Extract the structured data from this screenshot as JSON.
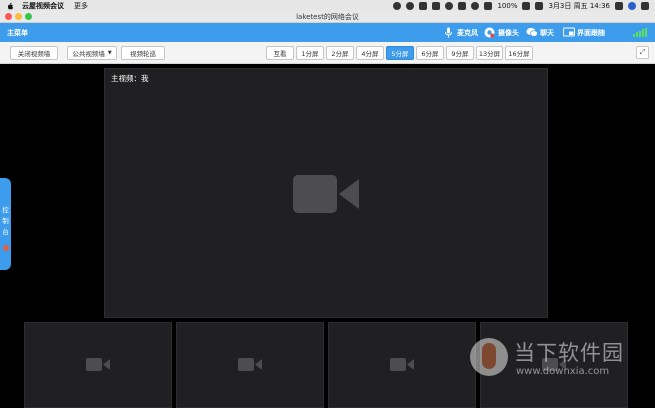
{
  "mac_menubar": {
    "app_name": "云屋视频会议",
    "menu_more": "更多",
    "battery": "100%",
    "datetime": "3月3日 周五  14:36"
  },
  "window": {
    "title": "laketest的网络会议"
  },
  "toolbar": {
    "main_menu": "主菜单",
    "mic": "麦克风",
    "camera": "摄像头",
    "chat": "聊天",
    "screen_share": "界面跟随"
  },
  "controls": {
    "close_wall": "关闭视频墙",
    "public_wall": "公共视频墙",
    "rotate": "视频轮巡",
    "layouts": [
      "互看",
      "1分屏",
      "2分屏",
      "4分屏",
      "5分屏",
      "6分屏",
      "9分屏",
      "13分屏",
      "16分屏"
    ],
    "active_layout": "5分屏"
  },
  "main_video": {
    "label": "主视频：我"
  },
  "console": {
    "label_1": "控",
    "label_2": "制",
    "label_3": "台"
  },
  "watermark": {
    "text": "当下软件园",
    "url": "www.downxia.com"
  },
  "colors": {
    "accent": "#3d9cec",
    "panel": "#202022",
    "camera_icon": "#4d4d50"
  }
}
